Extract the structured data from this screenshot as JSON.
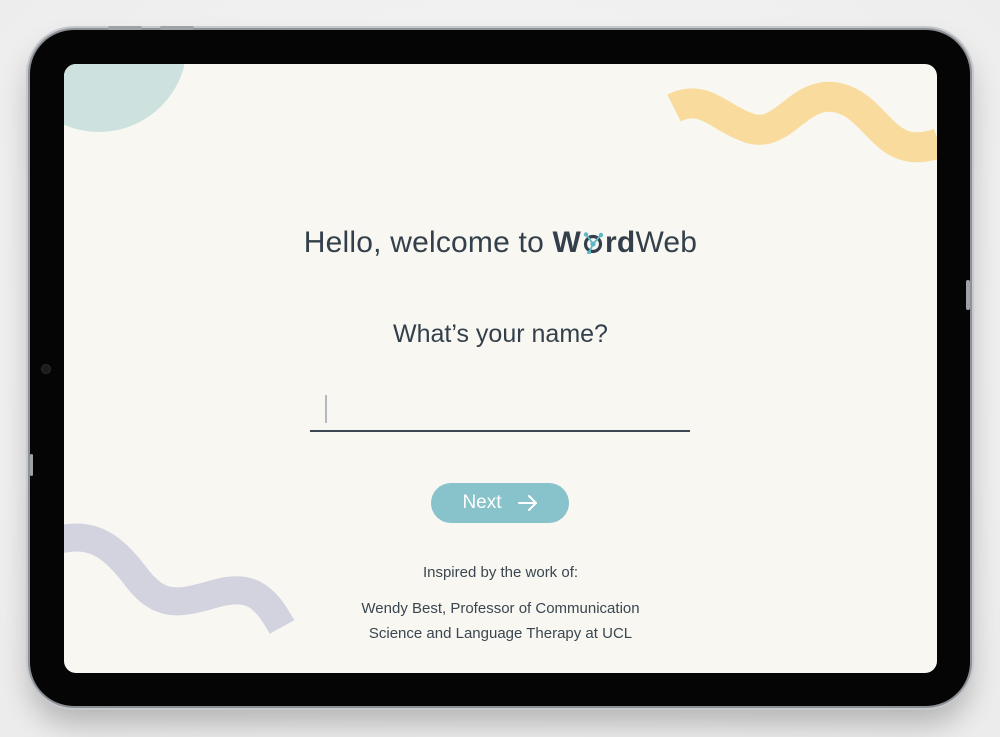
{
  "screen": {
    "heading_prefix": "Hello, welcome to",
    "brand": {
      "word_part_1": "W",
      "word_part_2": "rd",
      "web_part": "Web"
    },
    "question": "What’s your name?",
    "name_input": {
      "value": "",
      "placeholder": ""
    },
    "next_button": {
      "label": "Next",
      "icon": "arrow-right-icon"
    },
    "credit": {
      "lead": "Inspired by the work of:",
      "line1": "Wendy Best, Professor of Communication",
      "line2": "Science and Language Therapy at UCL"
    }
  },
  "colors": {
    "screen_background": "#f8f7f2",
    "text": "#33404b",
    "accent_button": "#88c2cb",
    "decor_teal_circle": "#cde1df",
    "decor_yellow_wave": "#f9dc9d",
    "decor_lavender_wave": "#d3d3e0"
  }
}
